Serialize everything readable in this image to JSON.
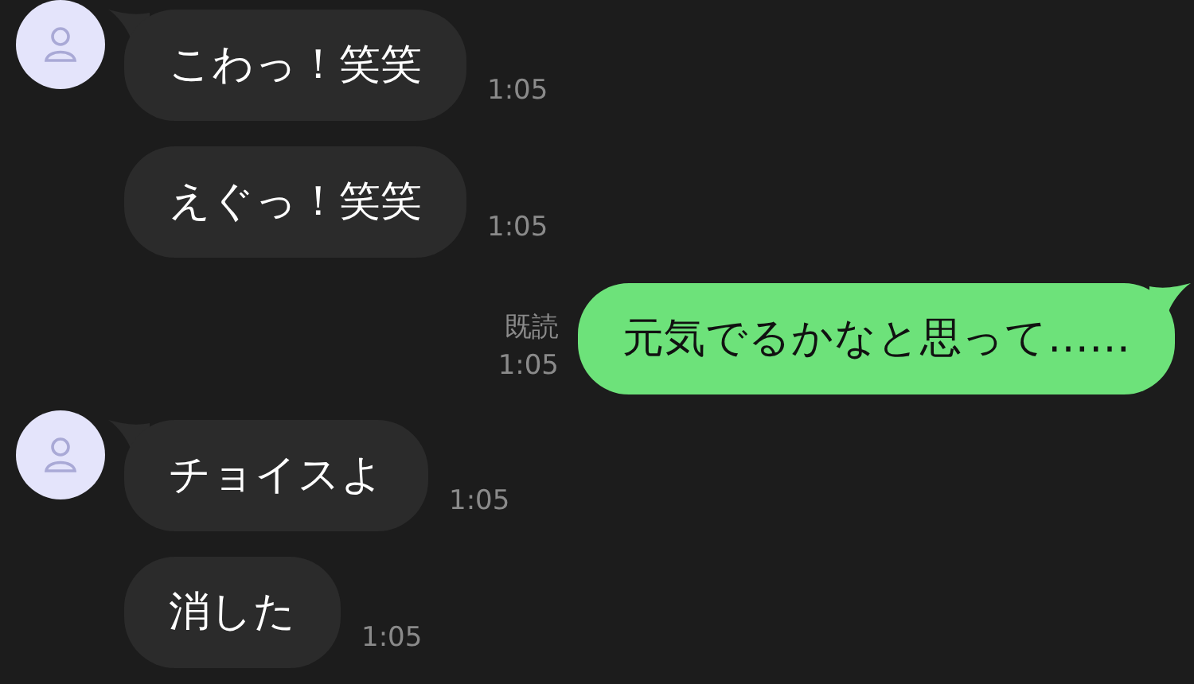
{
  "messages": [
    {
      "kind": "received",
      "show_avatar": true,
      "text": "こわっ！笑笑",
      "time": "1:05"
    },
    {
      "kind": "received",
      "show_avatar": false,
      "text": "えぐっ！笑笑",
      "time": "1:05"
    },
    {
      "kind": "sent",
      "text": "元気でるかなと思って……",
      "time": "1:05",
      "read": "既読"
    },
    {
      "kind": "received",
      "show_avatar": true,
      "text": "チョイスよ",
      "time": "1:05"
    },
    {
      "kind": "received",
      "show_avatar": false,
      "text": "消した",
      "time": "1:05"
    }
  ]
}
